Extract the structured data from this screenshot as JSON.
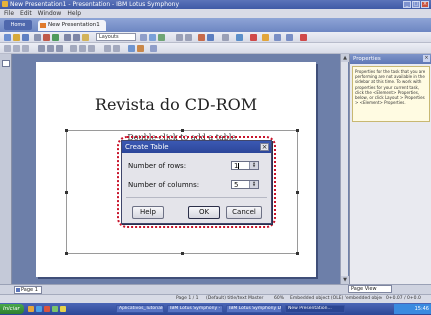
{
  "window": {
    "title": "New Presentation1 - Presentation - IBM Lotus Symphony"
  },
  "menu": [
    "File",
    "Edit",
    "Window",
    "Help"
  ],
  "tabs": {
    "home_label": "Home",
    "document_label": "New Presentation1"
  },
  "toolbar": {
    "layout_combo": "Layouts"
  },
  "slide": {
    "title": "Revista do CD-ROM",
    "placeholder_text": "Double-click to add a table."
  },
  "properties": {
    "header": "Properties",
    "help_text": "Properties for the task that you are performing are not available in the sidebar at this time. To work with properties for your current task, click the <Element> Properties, below, or click Layout > Properties > <Element> Properties."
  },
  "dialog": {
    "title": "Create Table",
    "rows_label": "Number of rows:",
    "rows_value": "1",
    "columns_label": "Number of columns:",
    "columns_value": "5",
    "help_button": "Help",
    "ok_button": "OK",
    "cancel_button": "Cancel"
  },
  "bottom": {
    "page_tab": "Page 1",
    "view_combo": "Page View"
  },
  "status": {
    "page": "Page 1 / 1",
    "layout": "(Default) title/text Master",
    "zoom": "60%",
    "selection": "Embedded object (OLE) 'embedded object (OLE)' selected",
    "coords": "0+0.07 / 0+0.0"
  },
  "taskbar": {
    "start": "Iniciar",
    "tasks": [
      "Aplicativos_Tutorials",
      "IBM Lotus Symphony - doc...",
      "IBM Lotus Symphony Docu...",
      "New Presentation..."
    ],
    "clock": "15:46"
  },
  "colors": {
    "highlight_frame": "#c8142b",
    "title_blue": "#3b59b3"
  }
}
